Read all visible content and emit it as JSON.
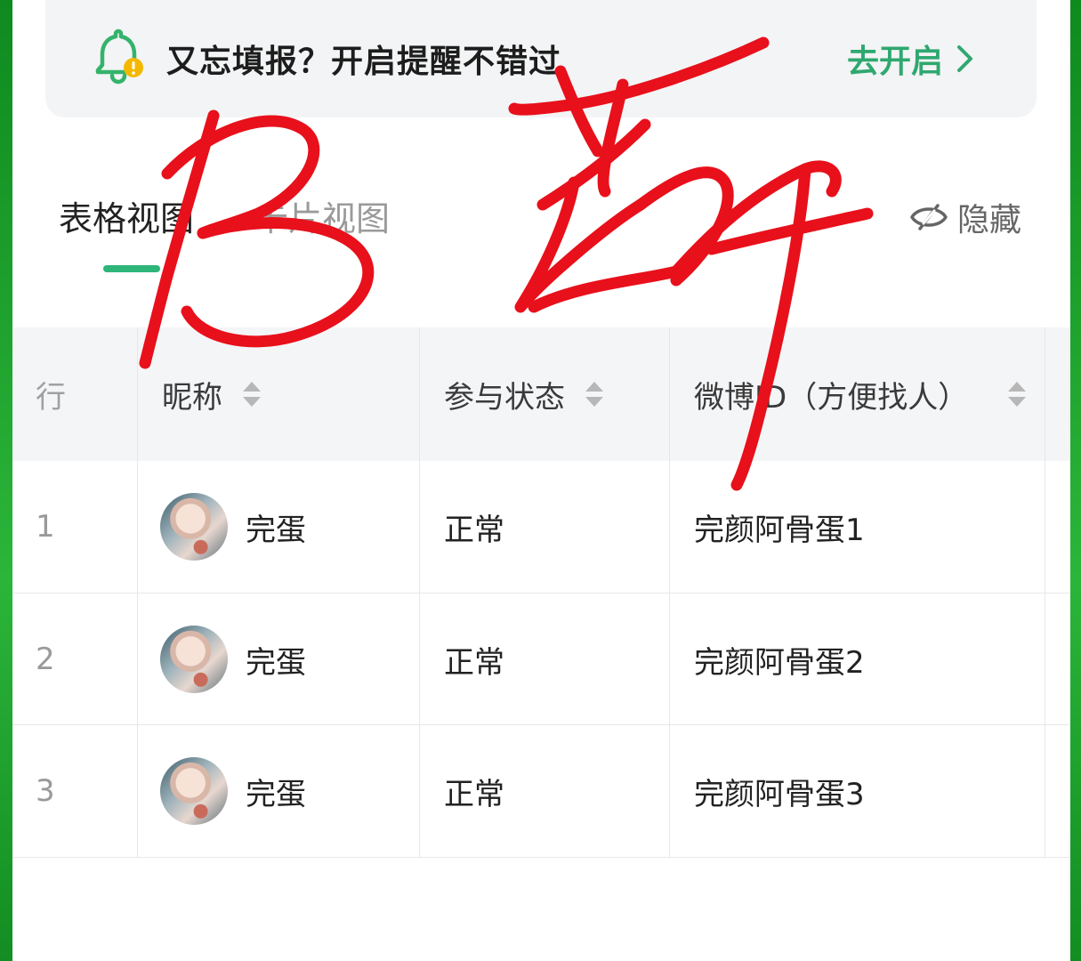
{
  "banner": {
    "text": "又忘填报？开启提醒不错过",
    "action_label": "去开启",
    "accent_color": "#2fa870",
    "icon": "bell-icon"
  },
  "tabs": [
    {
      "label": "表格视图",
      "active": true
    },
    {
      "label": "卡片视图",
      "active": false
    }
  ],
  "toolbar": {
    "hide_label": "隐藏",
    "hide_icon": "eye-off-icon"
  },
  "table": {
    "columns": [
      {
        "label": "行"
      },
      {
        "label": "昵称"
      },
      {
        "label": "参与状态"
      },
      {
        "label": "微博ID（方便找人）"
      }
    ],
    "rows": [
      {
        "index": "1",
        "nickname": "完蛋",
        "status": "正常",
        "weibo_id": "完颜阿骨蛋1"
      },
      {
        "index": "2",
        "nickname": "完蛋",
        "status": "正常",
        "weibo_id": "完颜阿骨蛋2"
      },
      {
        "index": "3",
        "nickname": "完蛋",
        "status": "正常",
        "weibo_id": "完颜阿骨蛋3"
      }
    ]
  },
  "colors": {
    "frame": "#1a9a2c",
    "tab_underline": "#2fb57a",
    "ink": "#e8101b"
  }
}
